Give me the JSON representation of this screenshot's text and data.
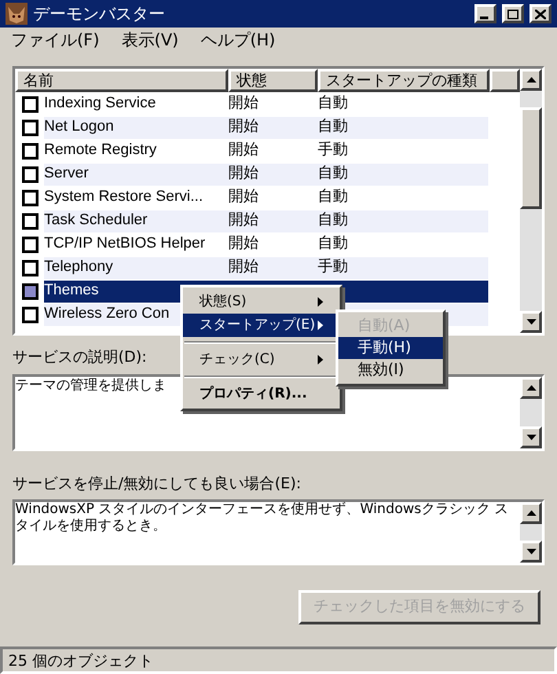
{
  "window": {
    "title": "デーモンバスター"
  },
  "menu_bar": [
    "ファイル(F)",
    "表示(V)",
    "ヘルプ(H)"
  ],
  "table": {
    "columns": [
      "名前",
      "状態",
      "スタートアップの種類"
    ],
    "rows": [
      {
        "name": "Indexing Service",
        "status": "開始",
        "startup": "自動",
        "checked": false,
        "selected": false
      },
      {
        "name": "Net Logon",
        "status": "開始",
        "startup": "自動",
        "checked": false,
        "selected": false
      },
      {
        "name": "Remote Registry",
        "status": "開始",
        "startup": "手動",
        "checked": false,
        "selected": false
      },
      {
        "name": "Server",
        "status": "開始",
        "startup": "自動",
        "checked": false,
        "selected": false
      },
      {
        "name": "System Restore Servi...",
        "status": "開始",
        "startup": "自動",
        "checked": false,
        "selected": false
      },
      {
        "name": "Task Scheduler",
        "status": "開始",
        "startup": "自動",
        "checked": false,
        "selected": false
      },
      {
        "name": "TCP/IP NetBIOS Helper",
        "status": "開始",
        "startup": "自動",
        "checked": false,
        "selected": false
      },
      {
        "name": "Telephony",
        "status": "開始",
        "startup": "手動",
        "checked": false,
        "selected": false
      },
      {
        "name": "Themes",
        "checked": false,
        "selected": true
      },
      {
        "name": "Wireless Zero Con",
        "checked": false,
        "selected": false
      }
    ]
  },
  "context_menu": {
    "items": [
      {
        "label": "状態(S)",
        "kind": "submenu",
        "selected": false
      },
      {
        "label": "スタートアップ(E)",
        "kind": "submenu",
        "selected": true
      },
      {
        "label": "チェック(C)",
        "kind": "submenu",
        "selected": false
      },
      {
        "label": "プロパティ(R)...",
        "kind": "default",
        "selected": false
      }
    ],
    "submenu": [
      {
        "label": "自動(A)",
        "disabled": true,
        "selected": false
      },
      {
        "label": "手動(H)",
        "disabled": false,
        "selected": true
      },
      {
        "label": "無効(I)",
        "disabled": false,
        "selected": false
      }
    ]
  },
  "description": {
    "label": "サービスの説明(D):",
    "value": "テーマの管理を提供しま"
  },
  "disable_note": {
    "label": "サービスを停止/無効にしても良い場合(E):",
    "value": "WindowsXP スタイルのインターフェースを使用せず、Windowsクラシック スタイルを使用するとき。"
  },
  "disable_button": {
    "label": "チェックした項目を無効にする",
    "disabled": true
  },
  "status_bar": "25 個のオブジェクト"
}
